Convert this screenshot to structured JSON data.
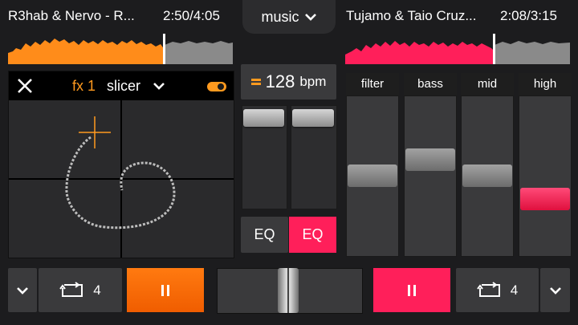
{
  "deck_left": {
    "track_title": "R3hab & Nervo - R...",
    "time_elapsed": "2:50",
    "time_total": "4:05",
    "waveform_color": "#ff8c1a",
    "loop_count": "4"
  },
  "deck_right": {
    "track_title": "Tujamo & Taio Cruz...",
    "time_elapsed": "2:08",
    "time_total": "3:15",
    "waveform_color": "#ff1f5a",
    "loop_count": "4"
  },
  "header": {
    "music_label": "music"
  },
  "fx": {
    "fx_label": "fx 1",
    "effect_name": "slicer",
    "accent_color": "#ff9a1f"
  },
  "tempo": {
    "bpm_value": "128",
    "bpm_unit": "bpm"
  },
  "eq_buttons": {
    "left_label": "EQ",
    "right_label": "EQ",
    "right_active_color": "#ff1f5a"
  },
  "eq": {
    "columns": [
      {
        "label": "filter"
      },
      {
        "label": "bass"
      },
      {
        "label": "mid"
      },
      {
        "label": "high"
      }
    ]
  },
  "icons": {
    "close": "close-icon",
    "chevron": "chevron-down-icon",
    "loop": "loop-icon",
    "pause": "pause-icon",
    "toggle": "toggle-icon",
    "tempo": "tempo-icon"
  }
}
